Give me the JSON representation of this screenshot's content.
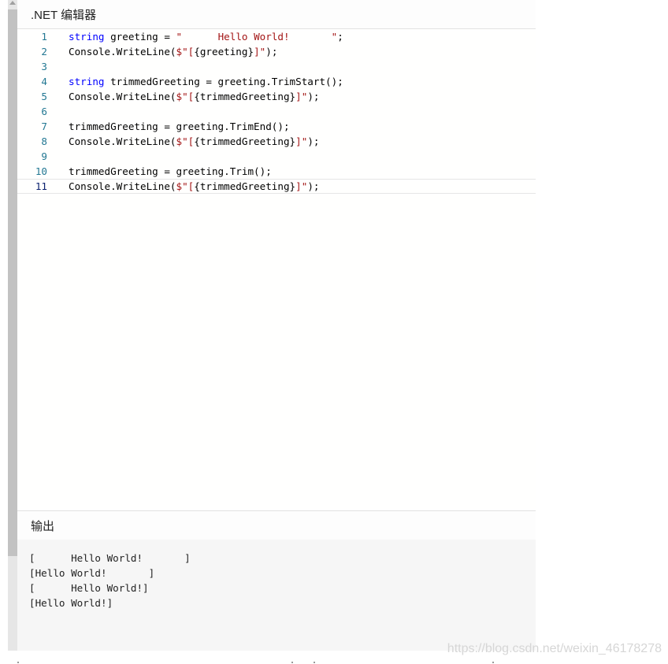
{
  "editor": {
    "title": ".NET 编辑器",
    "lines": [
      {
        "n": "1",
        "parts": [
          [
            "kw",
            "string"
          ],
          [
            "t",
            " greeting = "
          ],
          [
            "s",
            "\"      Hello World!       \""
          ],
          [
            "t",
            ";"
          ]
        ]
      },
      {
        "n": "2",
        "parts": [
          [
            "t",
            "Console.WriteLine("
          ],
          [
            "s",
            "$\"["
          ],
          [
            "t",
            "{greeting}"
          ],
          [
            "s",
            "]\""
          ],
          [
            "t",
            ");"
          ]
        ]
      },
      {
        "n": "3",
        "parts": []
      },
      {
        "n": "4",
        "parts": [
          [
            "kw",
            "string"
          ],
          [
            "t",
            " trimmedGreeting = greeting.TrimStart();"
          ]
        ]
      },
      {
        "n": "5",
        "parts": [
          [
            "t",
            "Console.WriteLine("
          ],
          [
            "s",
            "$\"["
          ],
          [
            "t",
            "{trimmedGreeting}"
          ],
          [
            "s",
            "]\""
          ],
          [
            "t",
            ");"
          ]
        ]
      },
      {
        "n": "6",
        "parts": []
      },
      {
        "n": "7",
        "parts": [
          [
            "t",
            "trimmedGreeting = greeting.TrimEnd();"
          ]
        ]
      },
      {
        "n": "8",
        "parts": [
          [
            "t",
            "Console.WriteLine("
          ],
          [
            "s",
            "$\"["
          ],
          [
            "t",
            "{trimmedGreeting}"
          ],
          [
            "s",
            "]\""
          ],
          [
            "t",
            ");"
          ]
        ]
      },
      {
        "n": "9",
        "parts": []
      },
      {
        "n": "10",
        "parts": [
          [
            "t",
            "trimmedGreeting = greeting.Trim();"
          ]
        ]
      },
      {
        "n": "11",
        "parts": [
          [
            "t",
            "Console.WriteLine("
          ],
          [
            "s",
            "$\"["
          ],
          [
            "t",
            "{trimmedGreeting}"
          ],
          [
            "s",
            "]\""
          ],
          [
            "t",
            ");"
          ]
        ]
      }
    ],
    "current_line": 11
  },
  "output": {
    "title": "输出",
    "lines": [
      "[      Hello World!       ]",
      "[Hello World!       ]",
      "[      Hello World!]",
      "[Hello World!]"
    ]
  },
  "watermark": "https://blog.csdn.net/weixin_46178278",
  "colors": {
    "keyword": "#0000ff",
    "string": "#a31515",
    "line_number": "#237893"
  }
}
